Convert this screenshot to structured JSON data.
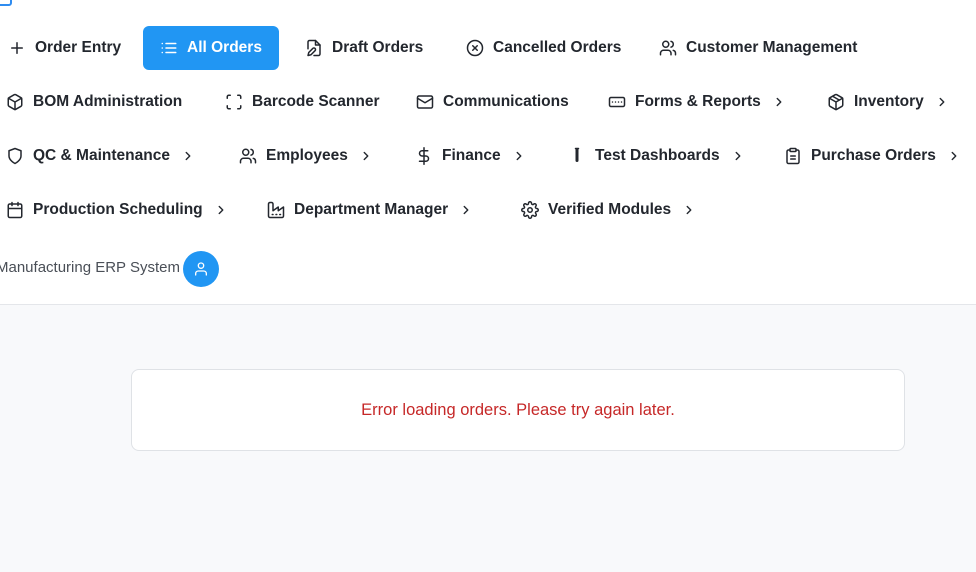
{
  "nav": {
    "row1": [
      {
        "label": "Order Entry",
        "icon": "plus-icon"
      },
      {
        "label": "All Orders",
        "icon": "list-icon",
        "active": true
      },
      {
        "label": "Draft Orders",
        "icon": "file-edit-icon"
      },
      {
        "label": "Cancelled Orders",
        "icon": "x-circle-icon"
      },
      {
        "label": "Customer Management",
        "icon": "users-icon"
      }
    ],
    "row2": [
      {
        "label": "BOM Administration",
        "icon": "box-icon"
      },
      {
        "label": "Barcode Scanner",
        "icon": "scan-icon"
      },
      {
        "label": "Communications",
        "icon": "mail-icon"
      },
      {
        "label": "Forms & Reports",
        "icon": "form-icon",
        "has_submenu": true
      },
      {
        "label": "Inventory",
        "icon": "package-icon",
        "has_submenu": true
      }
    ],
    "row3": [
      {
        "label": "QC & Maintenance",
        "icon": "shield-icon",
        "has_submenu": true
      },
      {
        "label": "Employees",
        "icon": "users-icon",
        "has_submenu": true
      },
      {
        "label": "Finance",
        "icon": "dollar-icon",
        "has_submenu": true
      },
      {
        "label": "Test Dashboards",
        "icon": "test-tube-icon",
        "has_submenu": true
      },
      {
        "label": "Purchase Orders",
        "icon": "clipboard-icon",
        "has_submenu": true
      }
    ],
    "row4": [
      {
        "label": "Production Scheduling",
        "icon": "calendar-icon",
        "has_submenu": true
      },
      {
        "label": "Department Manager",
        "icon": "factory-icon",
        "has_submenu": true
      },
      {
        "label": "Verified Modules",
        "icon": "gear-icon",
        "has_submenu": true
      }
    ]
  },
  "brand": {
    "title": "Manufacturing ERP System"
  },
  "main": {
    "error_message": "Error loading orders. Please try again later."
  },
  "colors": {
    "accent": "#2196f3",
    "error": "#c62828",
    "background": "#f8f9fb"
  }
}
